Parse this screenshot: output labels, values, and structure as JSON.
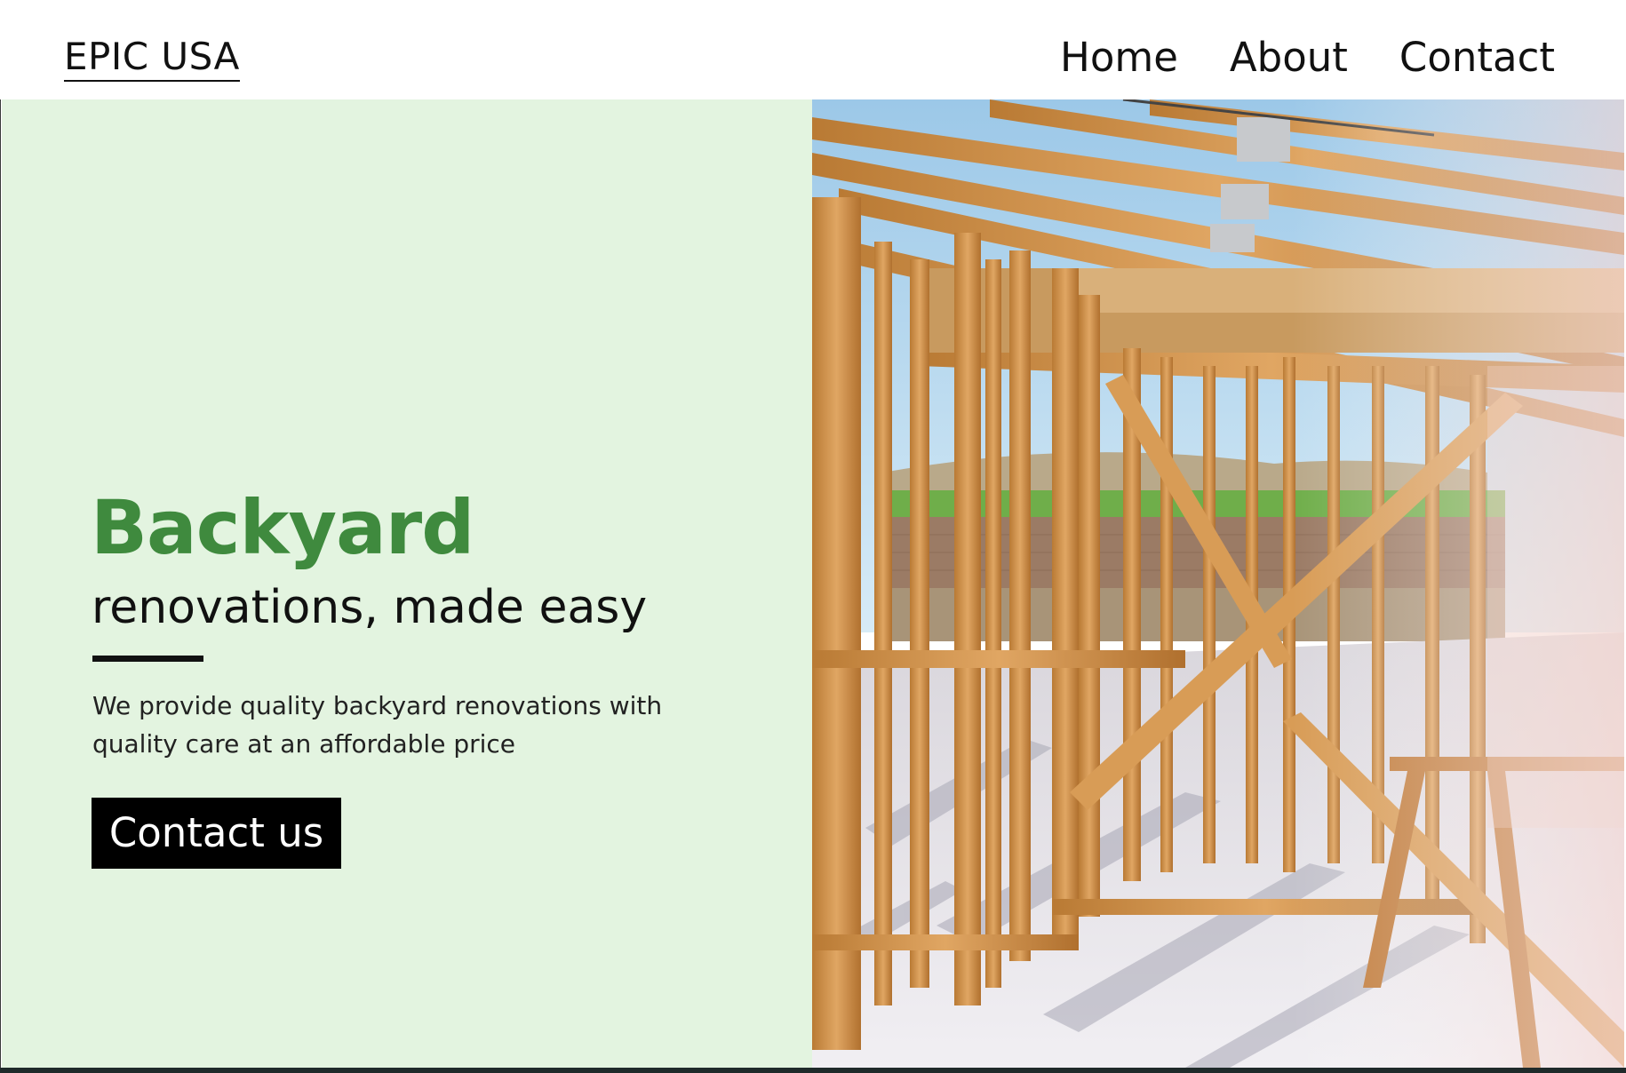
{
  "site": {
    "logo": "EPIC USA"
  },
  "nav": {
    "items": [
      "Home",
      "About",
      "Contact"
    ]
  },
  "hero": {
    "headline": "Backyard",
    "subheadline": "renovations, made easy",
    "description": "We provide quality backyard renovations with quality care at an affordable price",
    "cta_label": "Contact us",
    "image_subject": "house-frame-construction-photo"
  },
  "colors": {
    "accent_green": "#3f8a3e",
    "hero_bg": "#e3f4e0",
    "button_bg": "#000000"
  }
}
